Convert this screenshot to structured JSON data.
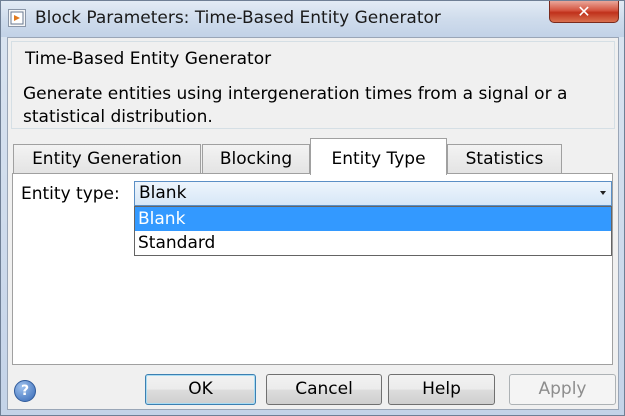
{
  "window": {
    "title": "Block Parameters: Time-Based Entity Generator",
    "close_label": "✕"
  },
  "description": {
    "title": "Time-Based Entity Generator",
    "text": "Generate entities using intergeneration times from a signal or a statistical distribution."
  },
  "tabs": [
    {
      "label": "Entity Generation",
      "active": false
    },
    {
      "label": "Blocking",
      "active": false
    },
    {
      "label": "Entity Type",
      "active": true
    },
    {
      "label": "Statistics",
      "active": false
    }
  ],
  "entity_type": {
    "label": "Entity type:",
    "selected": "Blank",
    "options": [
      "Blank",
      "Standard"
    ],
    "highlighted_option": "Blank"
  },
  "buttons": {
    "help_icon": "?",
    "ok": "OK",
    "cancel": "Cancel",
    "help": "Help",
    "apply": "Apply"
  }
}
